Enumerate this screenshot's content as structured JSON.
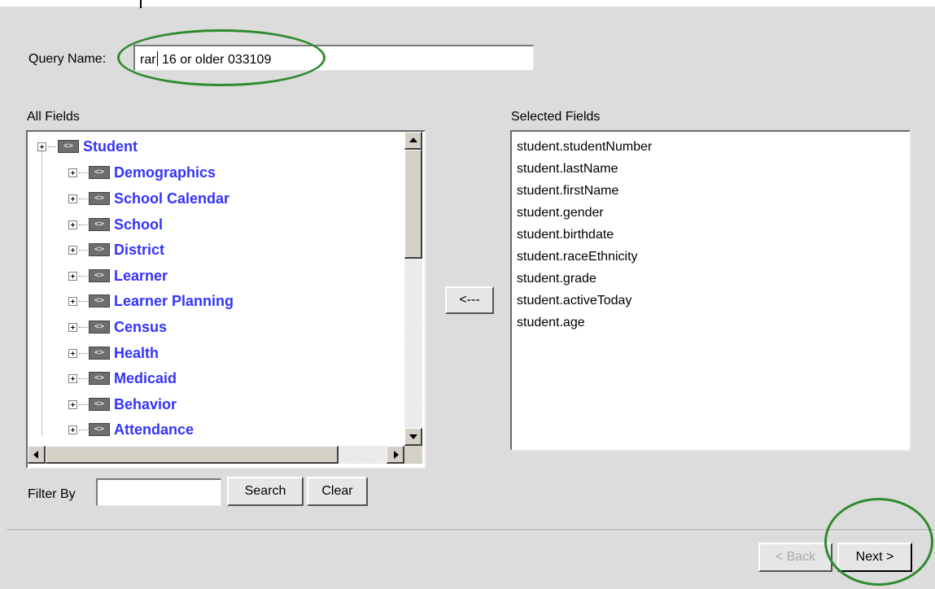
{
  "query": {
    "label": "Query Name:",
    "value_before_caret": "rar",
    "value_after_caret": " 16 or older 033109"
  },
  "all_fields": {
    "label": "All Fields",
    "root": {
      "label": "Student",
      "icon": "code-tag-icon"
    },
    "children": [
      {
        "label": "Demographics"
      },
      {
        "label": "School Calendar"
      },
      {
        "label": "School"
      },
      {
        "label": "District"
      },
      {
        "label": "Learner"
      },
      {
        "label": "Learner Planning"
      },
      {
        "label": "Census"
      },
      {
        "label": "Health"
      },
      {
        "label": "Medicaid"
      },
      {
        "label": "Behavior"
      },
      {
        "label": "Attendance"
      }
    ],
    "icon_text": "<>"
  },
  "move_button": {
    "label": "<---"
  },
  "selected_fields": {
    "label": "Selected Fields",
    "items": [
      "student.studentNumber",
      "student.lastName",
      "student.firstName",
      "student.gender",
      "student.birthdate",
      "student.raceEthnicity",
      "student.grade",
      "student.activeToday",
      "student.age"
    ]
  },
  "filter": {
    "label": "Filter By",
    "value": "",
    "search_label": "Search",
    "clear_label": "Clear"
  },
  "nav": {
    "back_label": "< Back",
    "next_label": "Next >"
  },
  "colors": {
    "tree_link": "#3333ff",
    "highlight_ellipse": "#2e8b2e",
    "background": "#dcdcdc"
  }
}
